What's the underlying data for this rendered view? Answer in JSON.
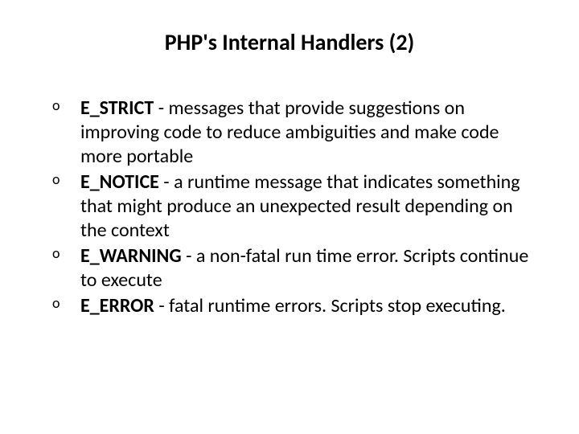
{
  "title": "PHP's Internal Handlers (2)",
  "items": [
    {
      "term": "E_STRICT",
      "separator": " -  ",
      "description": "messages that provide suggestions on improving code to reduce ambiguities and make code more portable"
    },
    {
      "term": "E_NOTICE",
      "separator": " - ",
      "description": "a runtime message that indicates something that might produce an unexpected result depending on the context"
    },
    {
      "term": "E_WARNING",
      "separator": " - ",
      "description": "a non-fatal run time error. Scripts continue to execute"
    },
    {
      "term": "E_ERROR",
      "separator": " - ",
      "description": "fatal runtime errors. Scripts stop executing."
    }
  ],
  "bullet": "o"
}
